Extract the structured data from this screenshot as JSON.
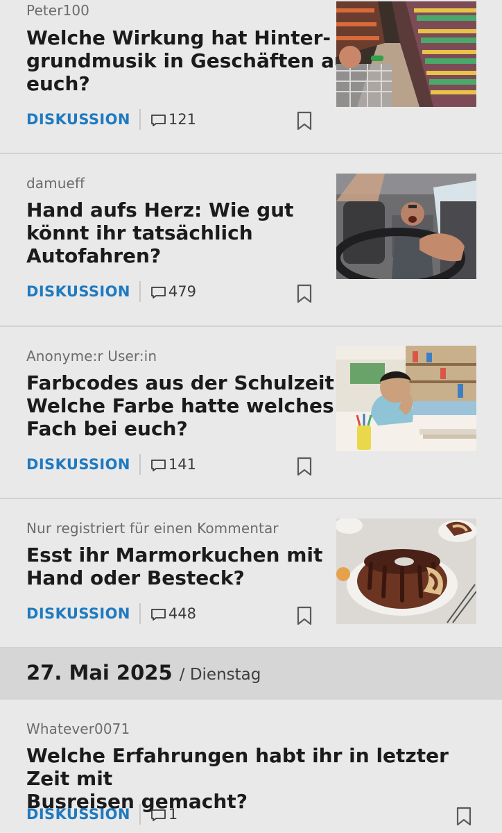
{
  "posts": [
    {
      "author": "Peter100",
      "title_lines": [
        "Welche Wirkung hat Hinter-",
        "grundmusik in Geschäften auf",
        "euch?"
      ],
      "type": "DISKUSSION",
      "comments": "121",
      "image": "supermarket-aisle-image"
    },
    {
      "author": "damueff",
      "title_lines": [
        "Hand aufs Herz: Wie gut",
        "könnt ihr tatsächlich",
        "Autofahren?"
      ],
      "type": "DISKUSSION",
      "comments": "479",
      "image": "angry-driver-image"
    },
    {
      "author": "Anonyme:r User:in",
      "title_lines": [
        "Farbcodes aus der Schulzeit:",
        "Welche Farbe hatte welches",
        "Fach bei euch?"
      ],
      "type": "DISKUSSION",
      "comments": "141",
      "image": "bored-student-image"
    },
    {
      "author": "Nur registriert für einen Kommentar",
      "title_lines": [
        "Esst ihr Marmorkuchen mit",
        "Hand oder Besteck?"
      ],
      "type": "DISKUSSION",
      "comments": "448",
      "image": "marble-cake-image"
    },
    {
      "author": "Whatever0071",
      "title_lines": [
        "Welche Erfahrungen habt ihr in letzter Zeit mit",
        "Busreisen gemacht?"
      ],
      "type": "DISKUSSION",
      "comments": "1"
    }
  ],
  "date_header": {
    "date": "27. Mai 2025",
    "day": "/ Dienstag"
  },
  "icons": {
    "comment": "comment-bubble-icon",
    "bookmark": "bookmark-icon"
  },
  "colors": {
    "accent": "#1f7ac0",
    "background": "#e9e9e9",
    "date_bar": "#d6d6d6"
  }
}
